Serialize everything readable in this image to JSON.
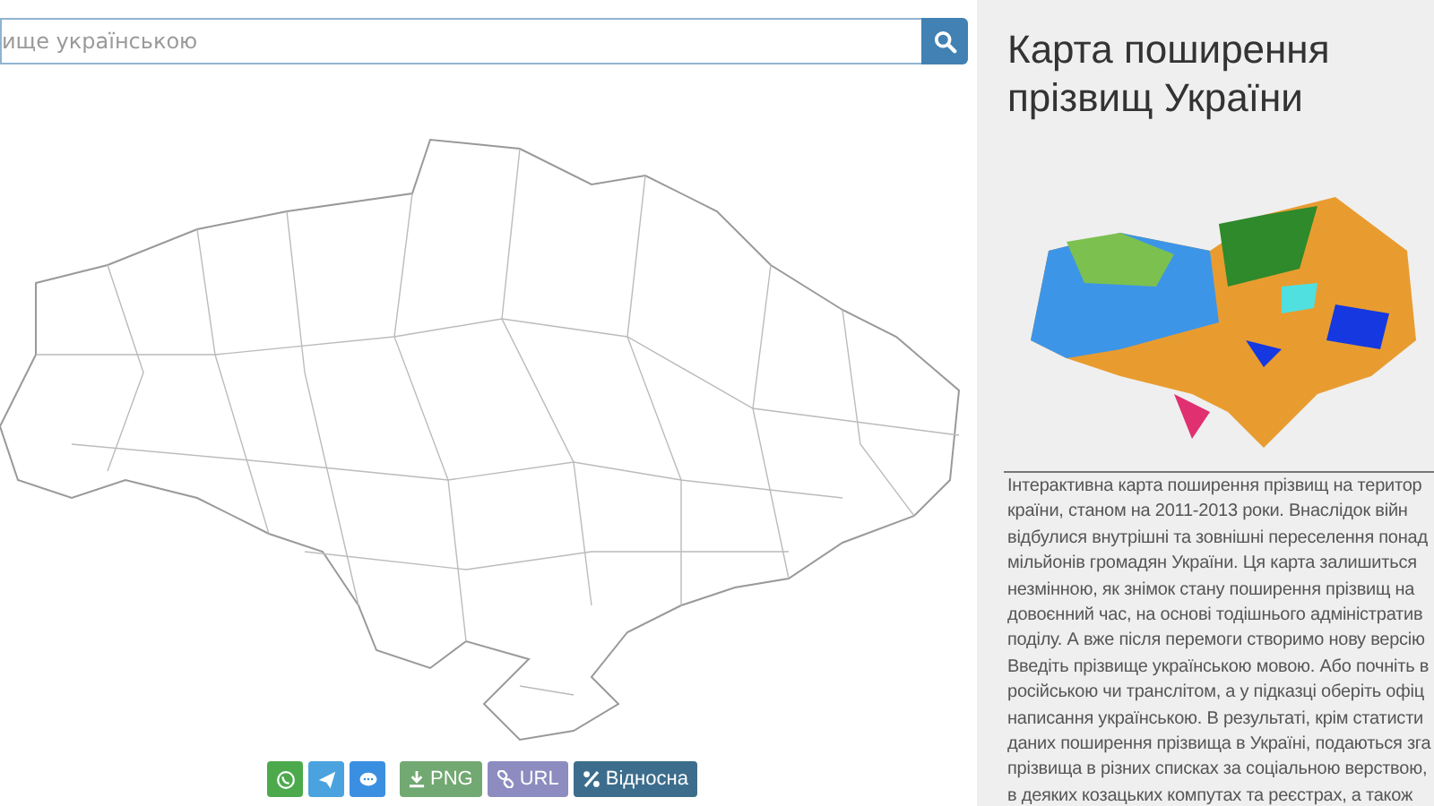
{
  "search": {
    "placeholder": "ище українською"
  },
  "share_buttons": [
    {
      "kind": "whatsapp"
    },
    {
      "kind": "telegram"
    },
    {
      "kind": "chat"
    }
  ],
  "export_buttons": [
    {
      "kind": "download",
      "label": "PNG"
    },
    {
      "kind": "link",
      "label": "URL"
    },
    {
      "kind": "percent",
      "label": "Відносна"
    }
  ],
  "sidebar": {
    "title": "Карта поширення прізвищ України",
    "description_lines": [
      "Інтерактивна карта поширення прізвищ на територ",
      "країни, станом на 2011-2013 роки. Внаслідок війн",
      "відбулися внутрішні та зовнішні переселення понад",
      "мільйонів громадян України. Ця карта залишиться",
      "незмінною, як знімок стану поширення прізвищ на",
      "довоєнний час, на основі тодішнього адміністратив",
      "поділу. А вже після перемоги створимо нову версію",
      "Введіть прізвище українською мовою. Або почніть в",
      "російською чи транслітом, а у підказці оберіть офіц",
      "написання українською. В результаті, крім статисти",
      "даних поширення прізвища в Україні, подаються зга",
      "прізвища в різних списках за соціальною верствою,",
      "в деяких козацьких компутах та реєстрах, а також"
    ]
  }
}
